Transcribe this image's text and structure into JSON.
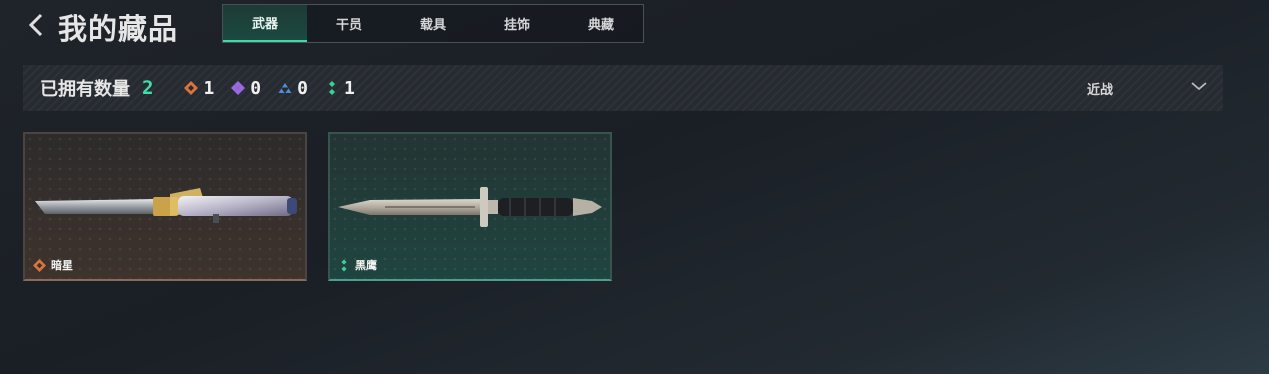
{
  "header": {
    "back_icon": "chevron-left-icon",
    "title": "我的藏品"
  },
  "tabs": [
    {
      "label": "武器",
      "active": true
    },
    {
      "label": "干员",
      "active": false
    },
    {
      "label": "载具",
      "active": false
    },
    {
      "label": "挂饰",
      "active": false
    },
    {
      "label": "典藏",
      "active": false
    }
  ],
  "summary": {
    "owned_label": "已拥有数量",
    "owned_count": "2",
    "stats": [
      {
        "icon": "orange-diamond-icon",
        "color": "#d9753a",
        "value": "1"
      },
      {
        "icon": "purple-diamond-icon",
        "color": "#9b6ae0",
        "value": "0"
      },
      {
        "icon": "blue-triangle-icon",
        "color": "#4b8fd6",
        "value": "0"
      },
      {
        "icon": "green-dots-icon",
        "color": "#3fcf95",
        "value": "1"
      }
    ],
    "filter": {
      "label": "近战",
      "icon": "chevron-down-icon"
    }
  },
  "items": [
    {
      "name": "暗星",
      "rarity_color": "#d9753a",
      "icon": "orange-diamond-icon"
    },
    {
      "name": "黑鹰",
      "rarity_color": "#3fcf95",
      "icon": "green-dots-icon"
    }
  ],
  "colors": {
    "accent": "#3fe0a8",
    "background": "#1c2127"
  }
}
